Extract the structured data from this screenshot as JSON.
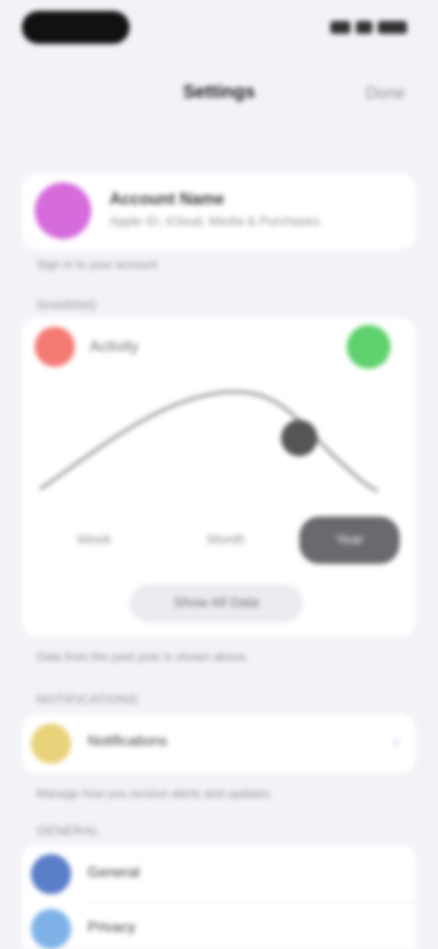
{
  "status_bar": {
    "icons": [
      "cellular-icon",
      "wifi-icon",
      "battery-icon"
    ]
  },
  "nav": {
    "title": "Settings",
    "done_label": "Done"
  },
  "profile": {
    "name": "Account Name",
    "subtitle": "Apple ID, iCloud, Media & Purchases",
    "avatar_color": "#d66bdc"
  },
  "profile_footnote": "Sign in to your account",
  "feature_group_label": "SHARING",
  "feature": {
    "label": "Activity",
    "red_icon_color": "#f47a74",
    "green_icon_color": "#5fd16d",
    "segments": [
      "Week",
      "Month",
      "Year"
    ],
    "active_segment": 2,
    "button_label": "Show All Data",
    "accent_color": "#6a6a6e"
  },
  "feature_footnote": "Data from the past year is shown above.",
  "group2_label": "NOTIFICATIONS",
  "group2": {
    "items": [
      {
        "label": "Notifications",
        "icon": "bell-icon",
        "color": "#e8d27a"
      }
    ],
    "chevron": "›"
  },
  "group2_footnote": "Manage how you receive alerts and updates.",
  "group3_label": "GENERAL",
  "group3": {
    "items": [
      {
        "label": "General",
        "icon": "gear-icon",
        "color": "#5b7ec9"
      },
      {
        "label": "Privacy",
        "icon": "hand-icon",
        "color": "#7fb3e8"
      }
    ]
  }
}
